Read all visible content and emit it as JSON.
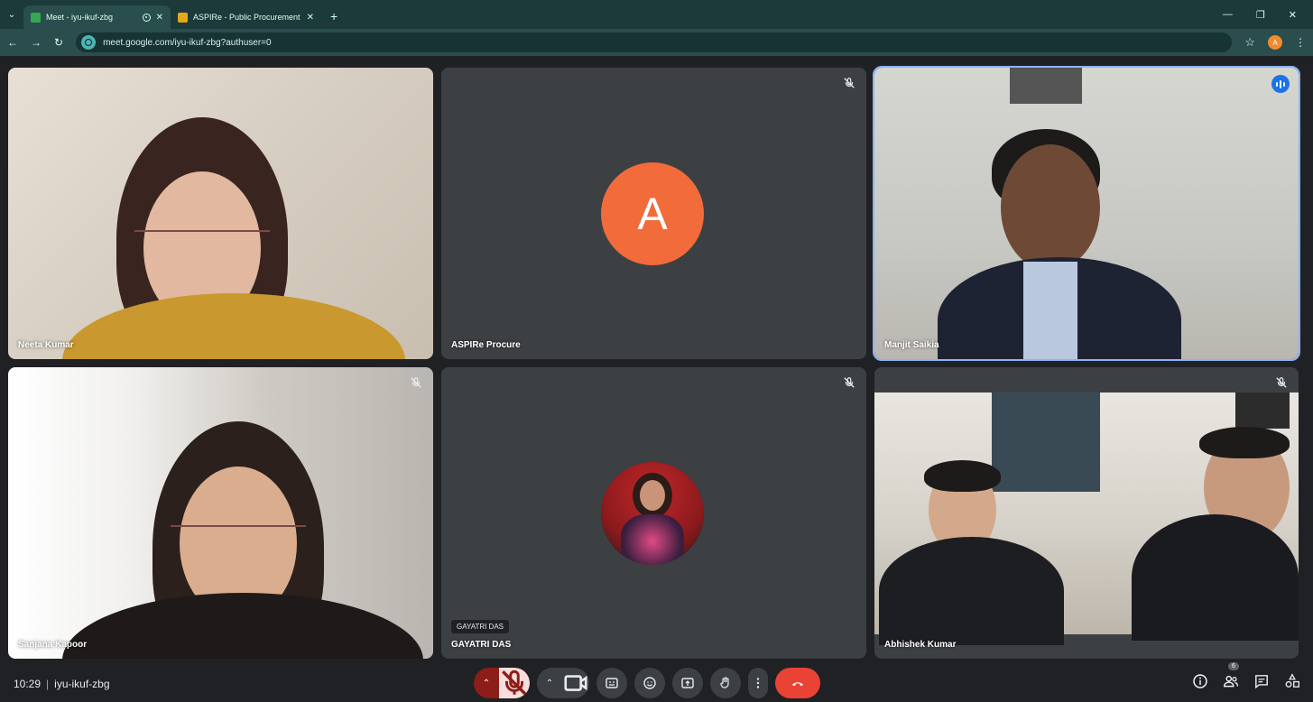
{
  "browser": {
    "tabs": [
      {
        "title": "Meet - iyu-ikuf-zbg",
        "active": true
      },
      {
        "title": "ASPIRe - Public Procurement in",
        "active": false
      }
    ],
    "url": "meet.google.com/iyu-ikuf-zbg?authuser=0",
    "profile_initial": "A"
  },
  "meeting": {
    "time": "10:29",
    "code": "iyu-ikuf-zbg",
    "participant_count": "6"
  },
  "tiles": [
    {
      "name": "Neeta Kumar",
      "muted": false
    },
    {
      "name": "ASPIRe Procure",
      "muted": true,
      "avatar_letter": "A",
      "avatar_color": "#f26b3a"
    },
    {
      "name": "Manjit Saikia",
      "muted": false,
      "speaking": true
    },
    {
      "name": "Sanjana Kapoor",
      "muted": true
    },
    {
      "name": "GAYATRI DAS",
      "muted": true,
      "chip": "GAYATRI DAS"
    },
    {
      "name": "Abhishek Kumar",
      "muted": true
    }
  ],
  "colors": {
    "stage_bg": "#202124",
    "tile_bg": "#3c4043",
    "hangup": "#ea4335",
    "speaking_outline": "#8ab4f8",
    "mic_muted_bg": "#f9dedc",
    "tab_bar": "#1c3a3a"
  }
}
